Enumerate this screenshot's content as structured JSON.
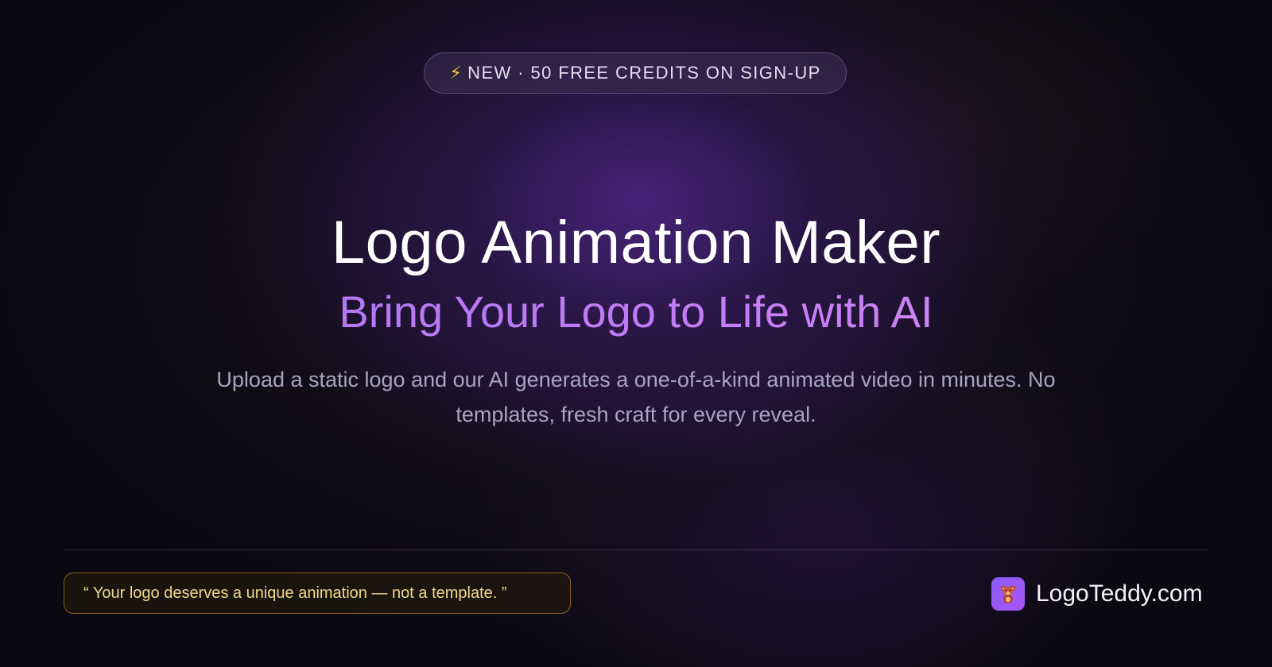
{
  "badge": {
    "icon": "lightning-bolt-icon",
    "text": "NEW · 50 FREE CREDITS ON SIGN-UP"
  },
  "hero": {
    "title": "Logo Animation Maker",
    "subtitle": "Bring Your Logo to Life with AI",
    "description": "Upload a static logo and our AI generates a one-of-a-kind animated video in minutes. No templates, fresh craft for every reveal."
  },
  "footer": {
    "quote": "“ Your logo deserves a unique animation — not a template. ”",
    "brand_icon": "teddy-bear-icon",
    "brand_name": "LogoTeddy.com"
  },
  "colors": {
    "background": "#0a0810",
    "accent_purple": "#a874f2",
    "quote_border": "#c88c28",
    "quote_text": "#f1d98a",
    "bolt": "#f5c542"
  }
}
